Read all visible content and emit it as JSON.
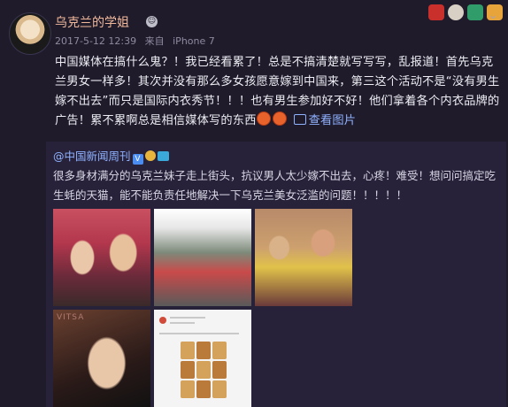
{
  "header": {
    "username": "乌克兰的学姐",
    "badge_icon": "robot-badge-icon",
    "timestamp": "2017-5-12 12:39",
    "source_label": "来自",
    "device": "iPhone 7"
  },
  "post": {
    "text": "中国媒体在搞什么鬼？！我已经看累了！总是不搞清楚就写写写，乱报道！首先乌克兰男女一样多！其次并没有那么多女孩愿意嫁到中国来，第三这个活动不是“没有男生嫁不出去”而只是国际内衣秀节！！！也有男生参加好不好！他们拿着各个内衣品牌的广告！累不累啊总是相信媒体写的东西",
    "view_images_label": "查看图片"
  },
  "repost": {
    "author": "@中国新闻周刊",
    "text": "很多身材满分的乌克兰妹子走上街头，抗议男人太少嫁不出去，心疼！难受！想问问搞定吃生蚝的天猫，能不能负责任地解决一下乌克兰美女泛滥的问题！！！！！",
    "photo4_label": "VITSA"
  },
  "colors": {
    "background": "#1f1b2b",
    "username": "#f0b89b",
    "link": "#8fb2ff"
  }
}
